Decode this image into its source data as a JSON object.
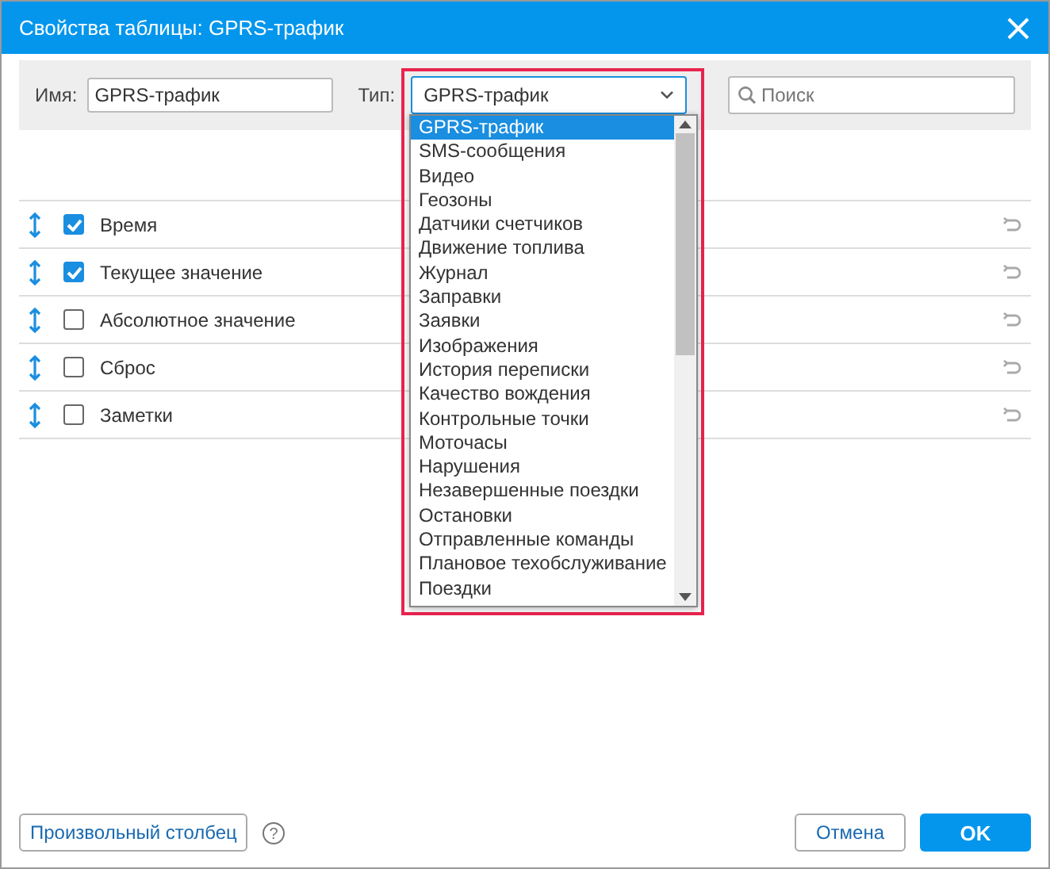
{
  "window": {
    "title": "Свойства таблицы: GPRS-трафик"
  },
  "filter": {
    "name_label": "Имя:",
    "name_value": "GPRS-трафик",
    "type_label": "Тип:",
    "type_value": "GPRS-трафик",
    "search_placeholder": "Поиск"
  },
  "dropdown": {
    "expanded": true,
    "options": [
      {
        "label": "GPRS-трафик",
        "selected": true
      },
      {
        "label": "SMS-сообщения",
        "selected": false
      },
      {
        "label": "Видео",
        "selected": false
      },
      {
        "label": "Геозоны",
        "selected": false
      },
      {
        "label": "Датчики счетчиков",
        "selected": false
      },
      {
        "label": "Движение топлива",
        "selected": false
      },
      {
        "label": "Журнал",
        "selected": false
      },
      {
        "label": "Заправки",
        "selected": false
      },
      {
        "label": "Заявки",
        "selected": false
      },
      {
        "label": "Изображения",
        "selected": false
      },
      {
        "label": "История переписки",
        "selected": false
      },
      {
        "label": "Качество вождения",
        "selected": false
      },
      {
        "label": "Контрольные точки",
        "selected": false
      },
      {
        "label": "Моточасы",
        "selected": false
      },
      {
        "label": "Нарушения",
        "selected": false
      },
      {
        "label": "Незавершенные поездки",
        "selected": false
      },
      {
        "label": "Остановки",
        "selected": false
      },
      {
        "label": "Отправленные команды",
        "selected": false
      },
      {
        "label": "Плановое техобслуживание",
        "selected": false
      },
      {
        "label": "Поездки",
        "selected": false
      }
    ]
  },
  "columns": [
    {
      "label": "Время",
      "checked": true
    },
    {
      "label": "Текущее значение",
      "checked": true
    },
    {
      "label": "Абсолютное значение",
      "checked": false
    },
    {
      "label": "Сброс",
      "checked": false
    },
    {
      "label": "Заметки",
      "checked": false
    }
  ],
  "footer": {
    "custom_column_button": "Произвольный столбец",
    "cancel_button": "Отмена",
    "ok_button": "OK",
    "help_mark": "?"
  }
}
